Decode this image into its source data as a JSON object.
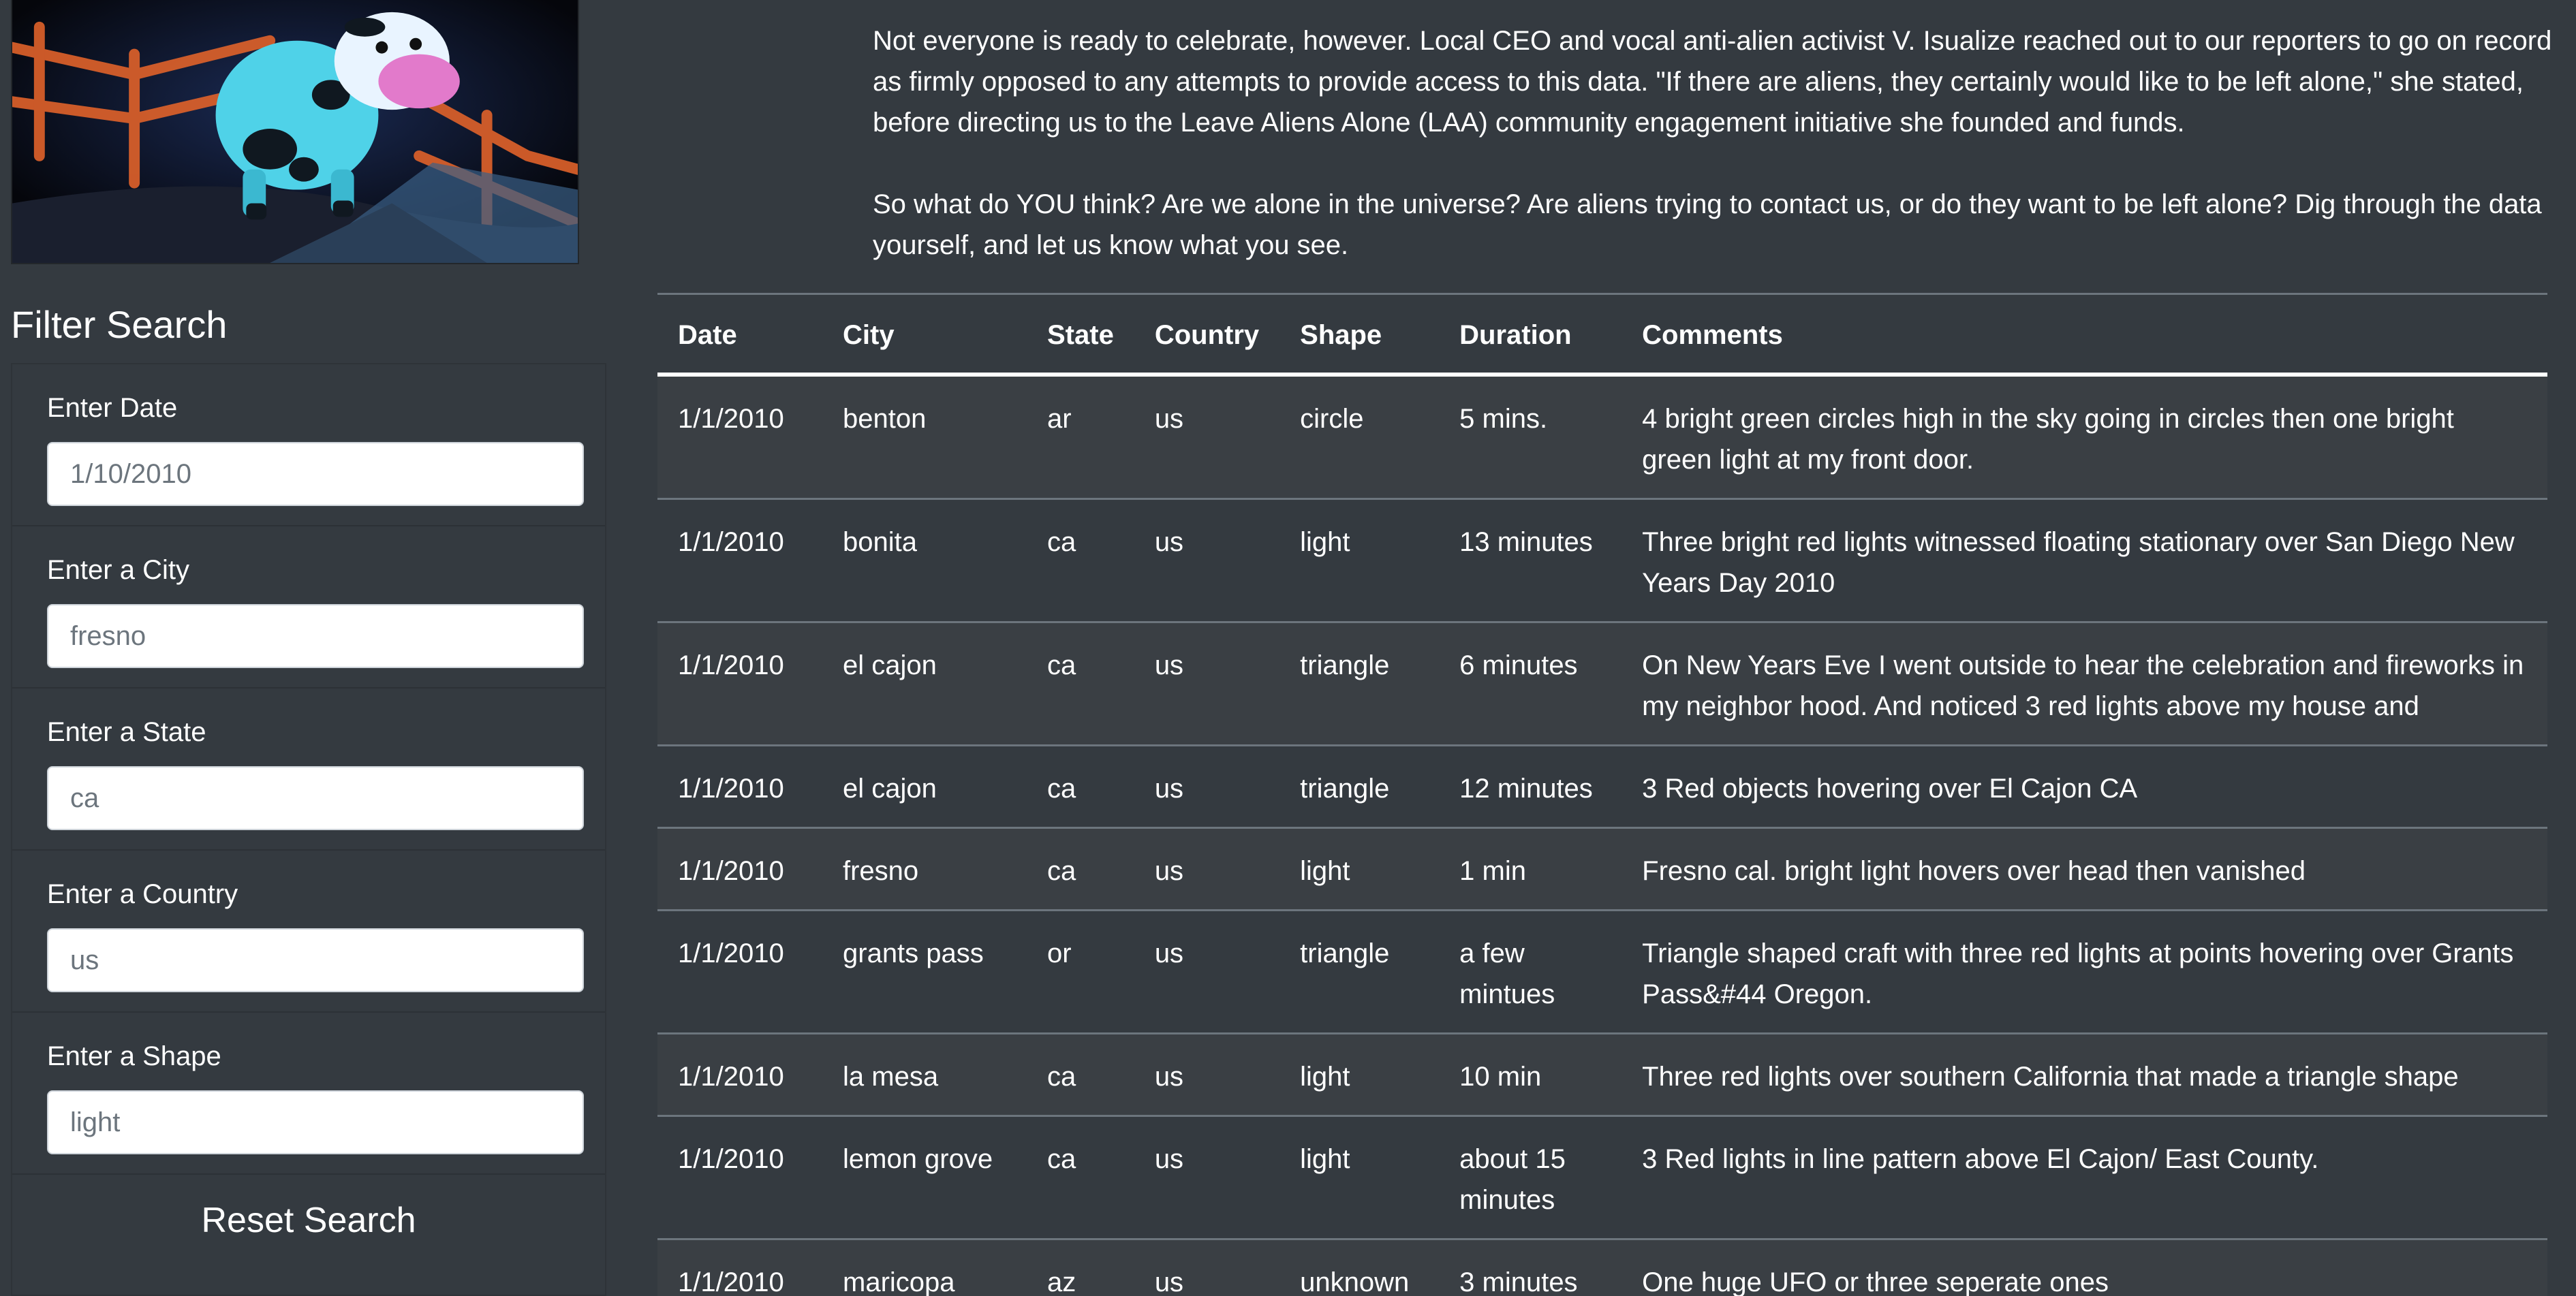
{
  "filter": {
    "title": "Filter Search",
    "fields": [
      {
        "label": "Enter Date",
        "placeholder": "1/10/2010"
      },
      {
        "label": "Enter a City",
        "placeholder": "fresno"
      },
      {
        "label": "Enter a State",
        "placeholder": "ca"
      },
      {
        "label": "Enter a Country",
        "placeholder": "us"
      },
      {
        "label": "Enter a Shape",
        "placeholder": "light"
      }
    ],
    "reset_label": "Reset Search"
  },
  "intro": {
    "paragraph1": "Not everyone is ready to celebrate, however. Local CEO and vocal anti-alien activist V. Isualize reached out to our reporters to go on record as firmly opposed to any attempts to provide access to this data. \"If there are aliens, they certainly would like to be left alone,\" she stated, before directing us to the Leave Aliens Alone (LAA) community engagement initiative she founded and funds.",
    "paragraph2": "So what do YOU think? Are we alone in the universe? Are aliens trying to contact us, or do they want to be left alone? Dig through the data yourself, and let us know what you see."
  },
  "table": {
    "headers": [
      "Date",
      "City",
      "State",
      "Country",
      "Shape",
      "Duration",
      "Comments"
    ],
    "rows": [
      [
        "1/1/2010",
        "benton",
        "ar",
        "us",
        "circle",
        "5 mins.",
        "4 bright green circles high in the sky going in circles then one bright green light at my front door."
      ],
      [
        "1/1/2010",
        "bonita",
        "ca",
        "us",
        "light",
        "13 minutes",
        "Three bright red lights witnessed floating stationary over San Diego New Years Day 2010"
      ],
      [
        "1/1/2010",
        "el cajon",
        "ca",
        "us",
        "triangle",
        "6 minutes",
        "On New Years Eve I went outside to hear the celebration and fireworks in my neighbor hood. And noticed 3 red lights above my house and"
      ],
      [
        "1/1/2010",
        "el cajon",
        "ca",
        "us",
        "triangle",
        "12 minutes",
        "3 Red objects hovering over El Cajon CA"
      ],
      [
        "1/1/2010",
        "fresno",
        "ca",
        "us",
        "light",
        "1 min",
        "Fresno cal. bright light hovers over head then vanished"
      ],
      [
        "1/1/2010",
        "grants pass",
        "or",
        "us",
        "triangle",
        "a few mintues",
        "Triangle shaped craft with three red lights at points hovering over Grants Pass&#44 Oregon."
      ],
      [
        "1/1/2010",
        "la mesa",
        "ca",
        "us",
        "light",
        "10 min",
        "Three red lights over southern California that made a triangle shape"
      ],
      [
        "1/1/2010",
        "lemon grove",
        "ca",
        "us",
        "light",
        "about 15 minutes",
        "3 Red lights in line pattern above El Cajon/ East County."
      ],
      [
        "1/1/2010",
        "maricopa",
        "az",
        "us",
        "unknown",
        "3 minutes",
        "One huge UFO or three seperate ones"
      ]
    ]
  },
  "colors": {
    "background": "#343a40",
    "stripe": "#3a3f44",
    "rule": "#6c757d",
    "text": "#ffffff"
  }
}
